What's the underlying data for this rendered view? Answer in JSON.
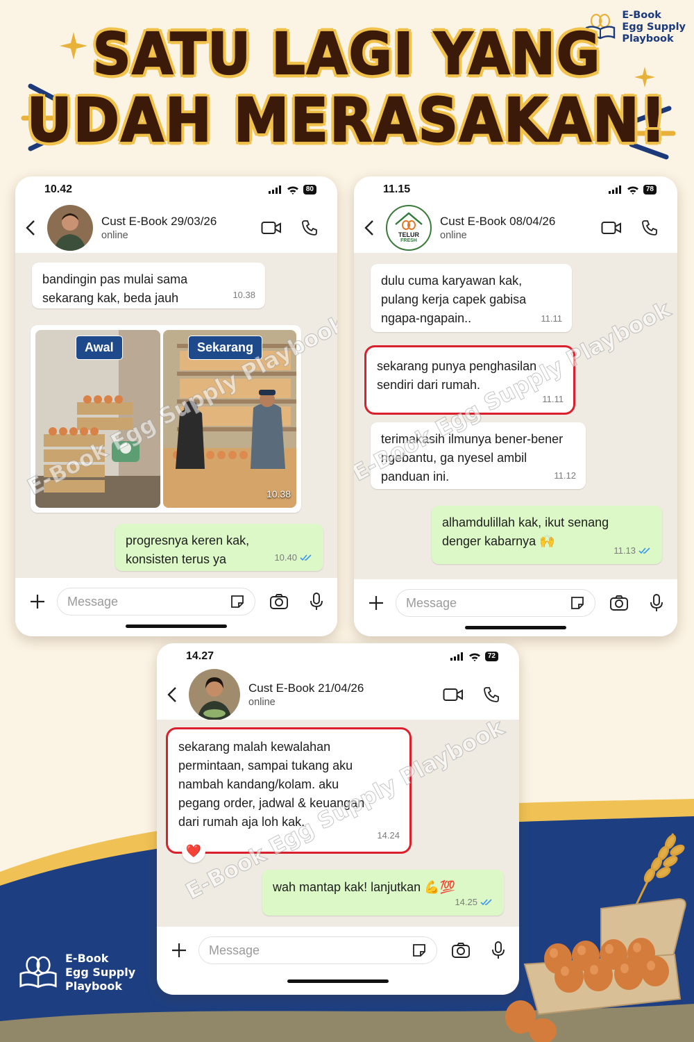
{
  "brand": {
    "name": "E-Book Egg Supply Playbook",
    "line1": "E-Book",
    "line2": "Egg Supply",
    "line3": "Playbook"
  },
  "headline": {
    "line1": "SATU LAGI YANG",
    "line2": "UDAH MERASAKAN!"
  },
  "watermark": "E-Book Egg Supply Playbook",
  "composer_placeholder": "Message",
  "colors": {
    "accent_blue": "#1c3a7a",
    "gold": "#f1c24b",
    "highlight_red": "#d9202c",
    "outgoing_bubble": "#dcf8c6"
  },
  "chat1": {
    "time": "10.42",
    "battery": "80",
    "contact": "Cust E-Book 29/03/26",
    "status": "online",
    "msg1": {
      "line1": "bandingin pas mulai sama",
      "line2": "sekarang kak, beda jauh",
      "time": "10.38"
    },
    "photo": {
      "label_before": "Awal",
      "label_after": "Sekarang",
      "time": "10.38"
    },
    "msg2": {
      "line1": "progresnya keren kak,",
      "line2": "konsisten terus ya",
      "time": "10.40"
    }
  },
  "chat2": {
    "time": "11.15",
    "battery": "78",
    "contact": "Cust E-Book 08/04/26",
    "status": "online",
    "avatar_text1": "TELUR",
    "avatar_text2": "FRESH",
    "msg1": {
      "line1": "dulu cuma karyawan kak,",
      "line2": "pulang kerja capek gabisa",
      "line3": "ngapa-ngapain..",
      "time": "11.11"
    },
    "msg2": {
      "line1": "sekarang punya penghasilan",
      "line2": "sendiri dari rumah.",
      "time": "11.11"
    },
    "msg3": {
      "line1": "terimakasih ilmunya bener-bener",
      "line2": "ngebantu, ga nyesel ambil",
      "line3": "panduan ini.",
      "time": "11.12"
    },
    "msg4": {
      "line1": "alhamdulillah kak, ikut senang",
      "line2": "denger kabarnya 🙌",
      "time": "11.13"
    }
  },
  "chat3": {
    "time": "14.27",
    "battery": "72",
    "contact": "Cust E-Book 21/04/26",
    "status": "online",
    "msg1": {
      "line1": "sekarang malah kewalahan",
      "line2": "permintaan, sampai tukang aku",
      "line3": "nambah kandang/kolam. aku",
      "line4": "pegang order, jadwal & keuangan",
      "line5": "dari rumah aja loh kak.",
      "time": "14.24",
      "reaction": "❤️"
    },
    "msg2": {
      "text": "wah mantap kak! lanjutkan 💪💯",
      "time": "14.25"
    }
  }
}
